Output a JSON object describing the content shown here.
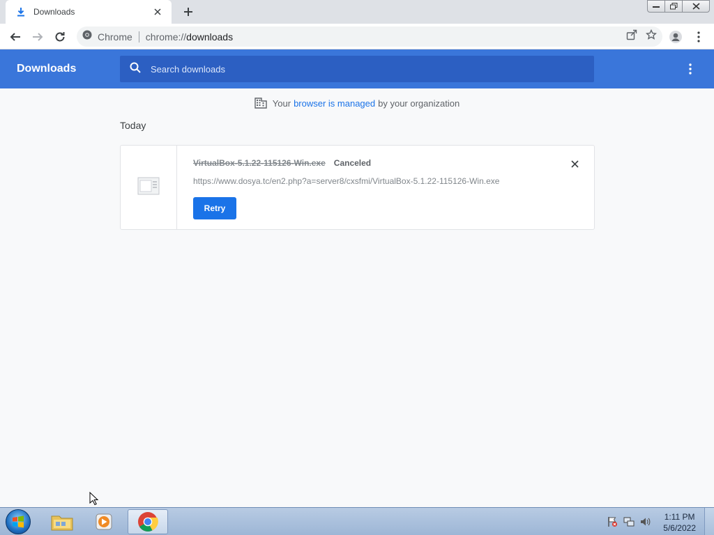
{
  "browser": {
    "tab": {
      "title": "Downloads",
      "icon": "download-icon"
    },
    "omnibox": {
      "site_label": "Chrome",
      "url_prefix": "chrome://",
      "url_path": "downloads"
    }
  },
  "downloads_page": {
    "title": "Downloads",
    "search_placeholder": "Search downloads",
    "managed_notice": {
      "prefix": "Your",
      "link": "browser is managed",
      "suffix": "by your organization"
    },
    "section_label": "Today",
    "items": [
      {
        "filename": "VirtualBox-5.1.22-115126-Win.exe",
        "status": "Canceled",
        "url": "https://www.dosya.tc/en2.php?a=server8/cxsfmi/VirtualBox-5.1.22-115126-Win.exe",
        "action_label": "Retry"
      }
    ]
  },
  "taskbar": {
    "clock_time": "1:11 PM",
    "clock_date": "5/6/2022"
  },
  "colors": {
    "header_blue": "#3a76da",
    "search_blue": "#2c5fc2",
    "link_blue": "#1a73e8"
  }
}
